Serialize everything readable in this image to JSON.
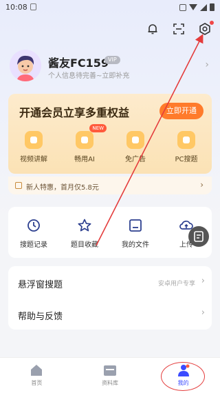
{
  "status_bar": {
    "time": "10:08"
  },
  "profile": {
    "nickname": "酱友FC159",
    "vip_badge": "VIP",
    "subtitle": "个人信息待完善~立即补充"
  },
  "vip_card": {
    "title": "开通会员立享多重权益",
    "open_button": "立即开通",
    "benefits": [
      {
        "label": "视频讲解",
        "icon": "video-icon"
      },
      {
        "label": "畅用AI",
        "icon": "ai-icon",
        "tag": "NEW"
      },
      {
        "label": "免广告",
        "icon": "ad-free-icon"
      },
      {
        "label": "PC搜题",
        "icon": "pc-search-icon"
      }
    ]
  },
  "promo": {
    "text": "新人特惠，首月仅5.8元"
  },
  "tools": [
    {
      "label": "搜题记录",
      "icon": "clock-icon"
    },
    {
      "label": "题目收藏",
      "icon": "star-icon"
    },
    {
      "label": "我的文件",
      "icon": "folder-icon"
    },
    {
      "label": "上传",
      "icon": "cloud-upload-icon"
    }
  ],
  "menu": [
    {
      "label": "悬浮窗搜题",
      "hint": "安卓用户专享"
    },
    {
      "label": "帮助与反馈",
      "hint": ""
    }
  ],
  "tabbar": [
    {
      "label": "首页",
      "icon": "home-icon"
    },
    {
      "label": "资料库",
      "icon": "library-icon"
    },
    {
      "label": "我的",
      "icon": "profile-icon",
      "active": true
    }
  ],
  "colors": {
    "accent": "#3b4bff",
    "vip_button": "#ff7b2b",
    "annotation": "#e43c3c"
  }
}
